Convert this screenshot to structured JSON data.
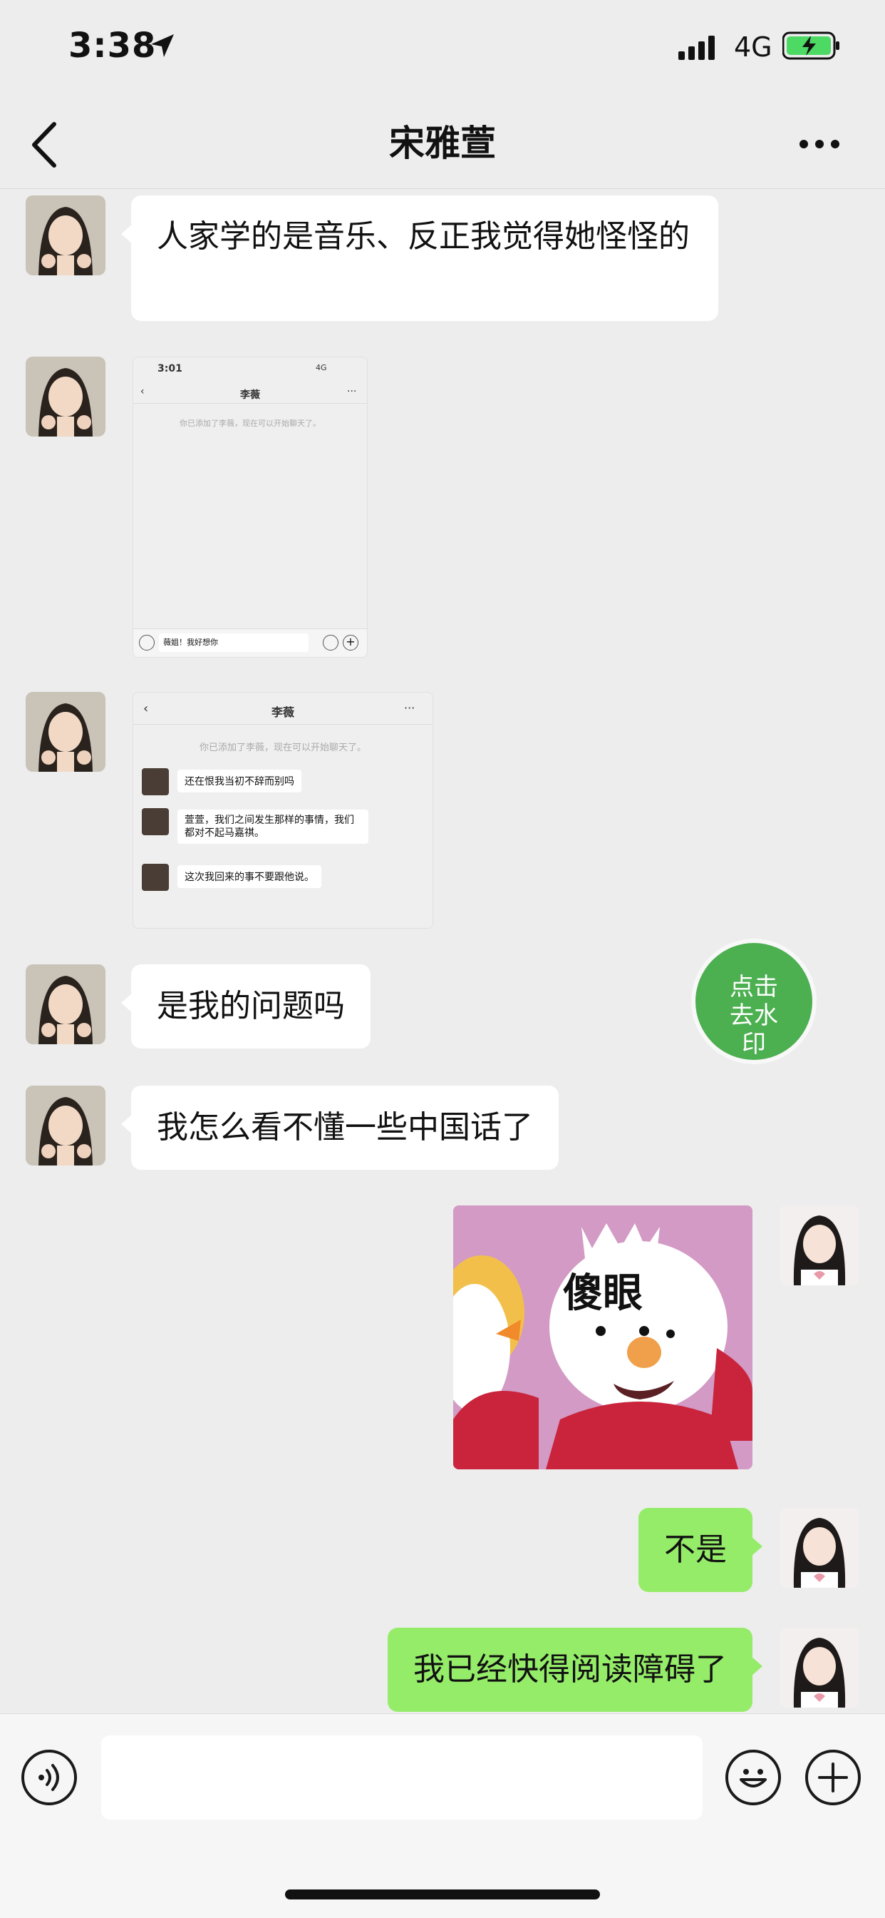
{
  "status": {
    "time": "3:38",
    "network": "4G"
  },
  "nav": {
    "title": "宋雅萱"
  },
  "messages": {
    "m1": "人家学的是音乐、反正我觉得她怪怪的",
    "m4": "是我的问题吗",
    "m5": "我怎么看不懂一些中国话了",
    "sticker_text": "傻眼",
    "m7": "不是",
    "m8": "我已经快得阅读障碍了"
  },
  "shot1": {
    "time": "3:01",
    "network": "4G",
    "title": "李薇",
    "system": "你已添加了李薇，现在可以开始聊天了。",
    "input": "薇姐！我好想你"
  },
  "shot2": {
    "title": "李薇",
    "system": "你已添加了李薇，现在可以开始聊天了。",
    "msgs": [
      "还在恨我当初不辞而别吗",
      "萱萱，我们之间发生那样的事情，我们都对不起马嘉祺。",
      "这次我回来的事不要跟他说。"
    ]
  },
  "watermark_button": {
    "label": "点击去水印"
  },
  "colors": {
    "outgoing": "#95ec69",
    "incoming": "#ffffff",
    "background": "#ededed",
    "watermark": "#4caf50"
  }
}
